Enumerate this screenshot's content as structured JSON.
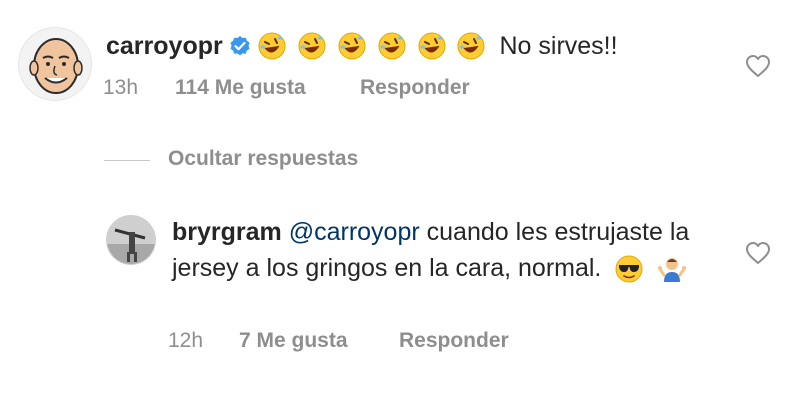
{
  "comment1": {
    "username": "carroyopr",
    "verified": true,
    "emojis": [
      "rolling-on-floor-laughing",
      "rolling-on-floor-laughing",
      "rolling-on-floor-laughing",
      "rolling-on-floor-laughing",
      "rolling-on-floor-laughing",
      "rolling-on-floor-laughing"
    ],
    "text": "No sirves!!",
    "time": "13h",
    "likes": "114 Me gusta",
    "reply_label": "Responder"
  },
  "replies_toggle": {
    "label": "Ocultar respuestas"
  },
  "comment2": {
    "username": "bryrgram",
    "mention": "@carroyopr",
    "text": "cuando les estrujaste la jersey a los gringos en la cara, normal.",
    "emojis": [
      "sunglasses-face",
      "person-shrugging"
    ],
    "time": "12h",
    "likes": "7 Me gusta",
    "reply_label": "Responder"
  },
  "colors": {
    "text": "#262626",
    "muted": "#8e8e8e",
    "mention": "#003569",
    "verified": "#3897f0"
  }
}
